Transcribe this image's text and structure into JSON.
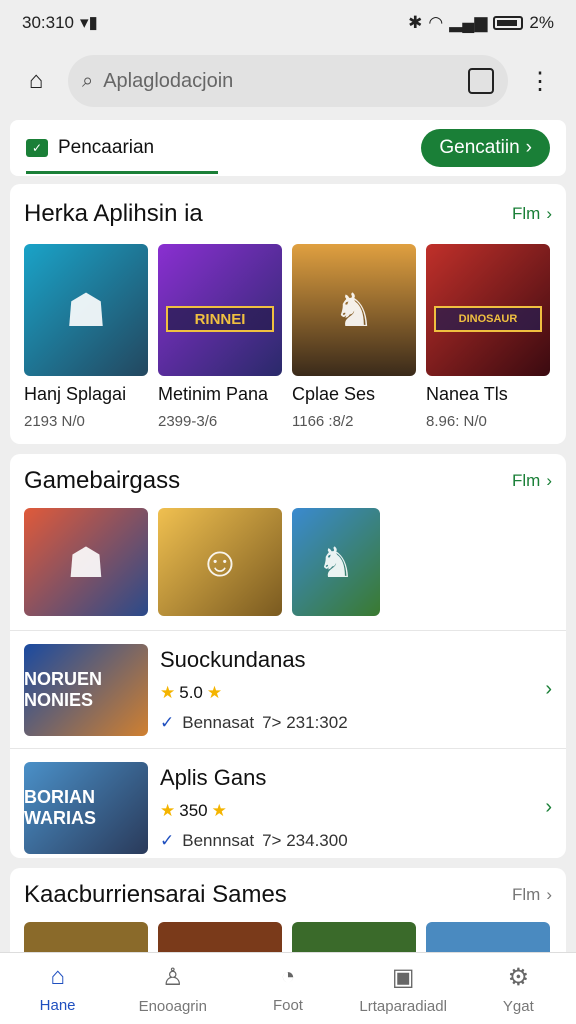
{
  "status": {
    "time": "30:310",
    "battery": "2%"
  },
  "search": {
    "placeholder": "Aplaglodacjoin"
  },
  "tab": {
    "label": "Pencaarian",
    "button": "Gencatiin"
  },
  "section1": {
    "title": "Herka Aplihsin ia",
    "more": "Flm",
    "apps": [
      {
        "name": "Hanj Splagai",
        "count": "2193 N/0"
      },
      {
        "name": "Metinim Pana",
        "count": "2399-3/6"
      },
      {
        "name": "Cplae Ses",
        "count": "1166 :8/2"
      },
      {
        "name": "Nanea Tls",
        "count": "8.96: N/0"
      }
    ],
    "banners": [
      "",
      "RINNEI",
      "",
      "DINOSAUR"
    ]
  },
  "section2": {
    "title": "Gamebairgass",
    "more": "Flm",
    "items": [
      {
        "title": "Suockundanas",
        "rating": "5.0",
        "publisher": "Bennasat",
        "meta": "7> 231:302",
        "thumb": "NORUEN NONIES"
      },
      {
        "title": "Aplis Gans",
        "rating": "350",
        "publisher": "Bennnsat",
        "meta": "7> 234.300",
        "thumb": "BORIAN WARIAS"
      }
    ]
  },
  "section3": {
    "title": "Kaacburriensarai Sames",
    "more": "Flm"
  },
  "nav": [
    {
      "label": "Hane"
    },
    {
      "label": "Enooagrin"
    },
    {
      "label": "Foot"
    },
    {
      "label": "Lrtaparadiadl"
    },
    {
      "label": "Ygat"
    }
  ],
  "colors": {
    "accent": "#1a7f37",
    "nav_active": "#1f4fbf"
  }
}
